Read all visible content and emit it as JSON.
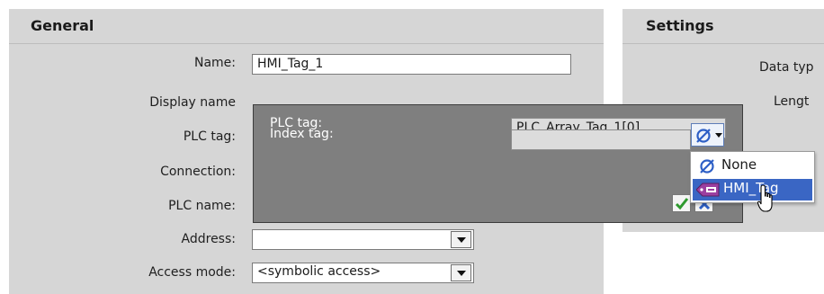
{
  "general": {
    "title": "General",
    "fields": {
      "name_label": "Name:",
      "name_value": "HMI_Tag_1",
      "display_name_label": "Display name",
      "plc_tag_label": "PLC tag:",
      "connection_label": "Connection:",
      "plc_name_label": "PLC name:",
      "address_label": "Address:",
      "address_value": "",
      "access_mode_label": "Access mode:",
      "access_mode_value": "<symbolic access>"
    }
  },
  "settings": {
    "title": "Settings",
    "data_type_label": "Data typ",
    "length_label": "Lengt"
  },
  "plc_tag_popup": {
    "plc_tag_label": "PLC tag:",
    "plc_tag_value": "PLC_Array_Tag_1[0]",
    "index_tag_label": "Index tag:",
    "index_tag_value": "",
    "index_tag_button_icon": "null-set-icon",
    "confirm_icon": "checkmark-icon",
    "cancel_icon": "x-icon"
  },
  "index_tag_menu": {
    "items": [
      {
        "label": "None",
        "icon": "null-set-icon",
        "selected": false
      },
      {
        "label": "HMI_Tag",
        "icon": "hmi-tag-icon",
        "selected": true
      }
    ]
  },
  "colors": {
    "panel_bg": "#d6d6d6",
    "popup_bg": "#7f7f7f",
    "selection": "#3a66c4",
    "confirm_green": "#2e9a2e",
    "icon_blue": "#2d5fc6",
    "tag_purple": "#9b3fa0"
  }
}
